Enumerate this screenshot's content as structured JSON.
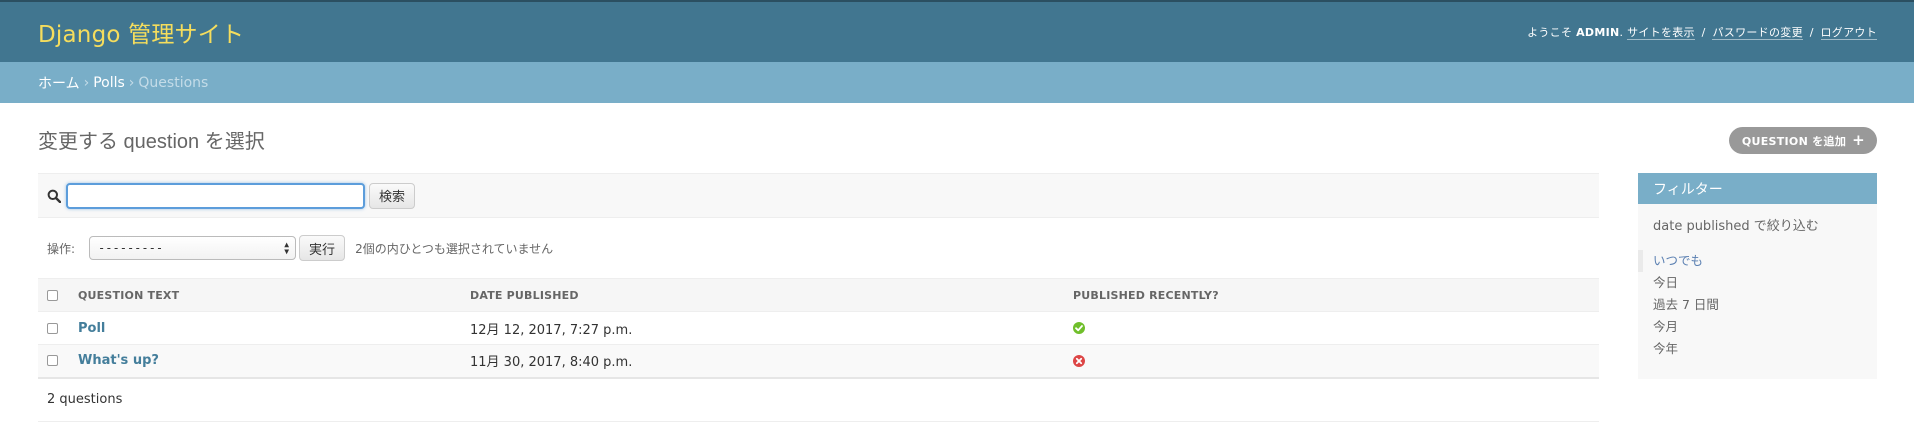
{
  "header": {
    "branding": "Django 管理サイト",
    "welcome": "ようこそ",
    "username": "ADMIN",
    "user_suffix": ".",
    "view_site": "サイトを表示",
    "change_password": "パスワードの変更",
    "logout": "ログアウト",
    "separator": "/"
  },
  "breadcrumbs": {
    "home": "ホーム",
    "app": "Polls",
    "current": "Questions",
    "separator": "›"
  },
  "page": {
    "title": "変更する question を選択",
    "add_button": "QUESTION を追加"
  },
  "search": {
    "value": "",
    "placeholder": "",
    "button": "検索"
  },
  "actions": {
    "label": "操作:",
    "selected_option": "---------",
    "go_button": "実行",
    "counter": "2個の内ひとつも選択されていません"
  },
  "table": {
    "headers": [
      "QUESTION TEXT",
      "DATE PUBLISHED",
      "PUBLISHED RECENTLY?"
    ],
    "rows": [
      {
        "question_text": "Poll",
        "date_published": "12月 12, 2017, 7:27 p.m.",
        "published_recently": "yes-icon"
      },
      {
        "question_text": "What's up?",
        "date_published": "11月 30, 2017, 8:40 p.m.",
        "published_recently": "no-icon"
      }
    ],
    "result_count": "2 questions"
  },
  "filter": {
    "title": "フィルター",
    "subtitle": "date published で絞り込む",
    "options": [
      "いつでも",
      "今日",
      "過去 7 日間",
      "今月",
      "今年"
    ],
    "selected_index": 0
  },
  "colors": {
    "header_bg": "#417690",
    "branding": "#f5dd5d",
    "breadcrumbs_bg": "#79aec8",
    "link": "#447e9b",
    "yes": "#70bf2b",
    "no": "#dd4646",
    "add_button_bg": "#999999"
  }
}
